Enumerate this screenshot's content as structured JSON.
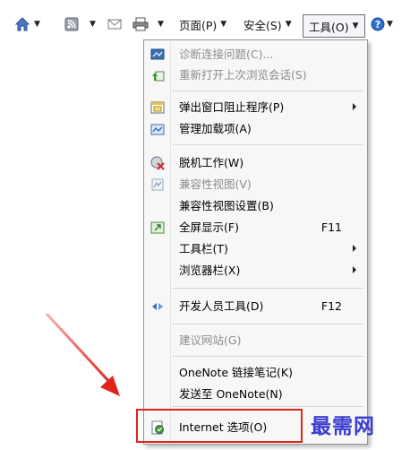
{
  "toolbar": {
    "page_label": "页面(P)",
    "safety_label": "安全(S)",
    "tools_label": "工具(O)"
  },
  "menu": {
    "items": [
      {
        "label": "诊断连接问题(C)...",
        "shortcut": "",
        "disabled": true,
        "icon": "diagnose-icon"
      },
      {
        "label": "重新打开上次浏览会话(S)",
        "shortcut": "",
        "disabled": true,
        "icon": "reopen-session-icon"
      },
      {
        "label": "弹出窗口阻止程序(P)",
        "shortcut": "",
        "disabled": false,
        "icon": "popup-blocker-icon",
        "submenu": true
      },
      {
        "label": "管理加载项(A)",
        "shortcut": "",
        "disabled": false,
        "icon": "addons-icon"
      },
      {
        "label": "脱机工作(W)",
        "shortcut": "",
        "disabled": false,
        "icon": "offline-icon"
      },
      {
        "label": "兼容性视图(V)",
        "shortcut": "",
        "disabled": true,
        "icon": "compat-view-icon"
      },
      {
        "label": "兼容性视图设置(B)",
        "shortcut": "",
        "disabled": false,
        "icon": ""
      },
      {
        "label": "全屏显示(F)",
        "shortcut": "F11",
        "disabled": false,
        "icon": "fullscreen-icon"
      },
      {
        "label": "工具栏(T)",
        "shortcut": "",
        "disabled": false,
        "icon": "",
        "submenu": true
      },
      {
        "label": "浏览器栏(X)",
        "shortcut": "",
        "disabled": false,
        "icon": "",
        "submenu": true
      },
      {
        "label": "开发人员工具(D)",
        "shortcut": "F12",
        "disabled": false,
        "icon": "developer-tools-icon"
      },
      {
        "label": "建议网站(G)",
        "shortcut": "",
        "disabled": true,
        "icon": ""
      },
      {
        "label": "OneNote 链接笔记(K)",
        "shortcut": "",
        "disabled": false,
        "icon": ""
      },
      {
        "label": "发送至 OneNote(N)",
        "shortcut": "",
        "disabled": false,
        "icon": ""
      },
      {
        "label": "Internet 选项(O)",
        "shortcut": "",
        "disabled": false,
        "icon": "internet-options-icon"
      }
    ]
  },
  "watermark": "最需网",
  "colors": {
    "highlight_border": "#e0231d",
    "arrow": "#e0231d",
    "watermark": "#3b3ecf"
  }
}
